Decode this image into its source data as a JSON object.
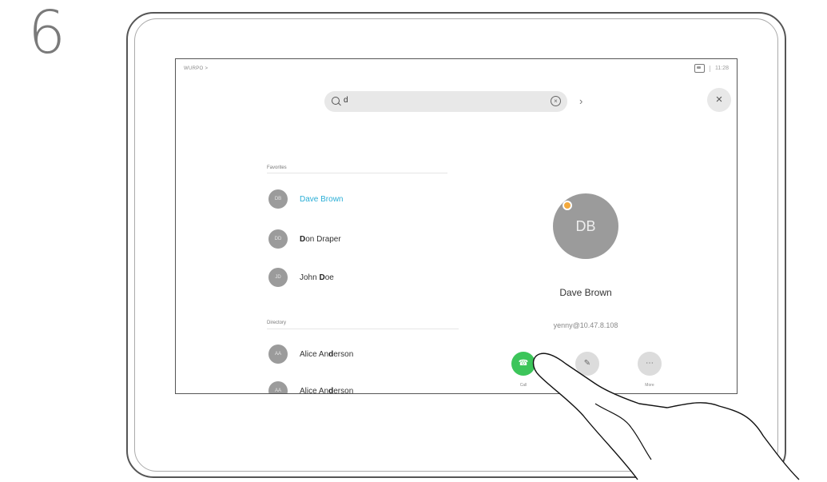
{
  "step_number": "6",
  "status_bar": {
    "left_text": "WURPO >",
    "time": "11:28"
  },
  "search": {
    "value": "d",
    "placeholder": ""
  },
  "sections": {
    "favorites": "Favorites",
    "directory": "Directory"
  },
  "favorites": [
    {
      "initials": "DB",
      "pre": "",
      "bold": "D",
      "post": "ave Brown",
      "selected": true
    },
    {
      "initials": "DD",
      "pre": "",
      "bold": "D",
      "post": "on Draper",
      "selected": false
    },
    {
      "initials": "JD",
      "pre": "John ",
      "bold": "D",
      "post": "oe",
      "selected": false
    }
  ],
  "directory": [
    {
      "initials": "AA",
      "pre": "Alice An",
      "bold": "d",
      "post": "erson"
    },
    {
      "initials": "AA",
      "pre": "Alice An",
      "bold": "d",
      "post": "erson"
    }
  ],
  "detail": {
    "initials": "DB",
    "name": "Dave Brown",
    "address": "yenny@10.47.8.108",
    "actions": {
      "call": "Call",
      "more": "More"
    }
  },
  "colors": {
    "accent": "#2aaed6",
    "call_green": "#3cc55a",
    "favorite_dot": "#f3a93c",
    "avatar_gray": "#9b9b9b"
  }
}
